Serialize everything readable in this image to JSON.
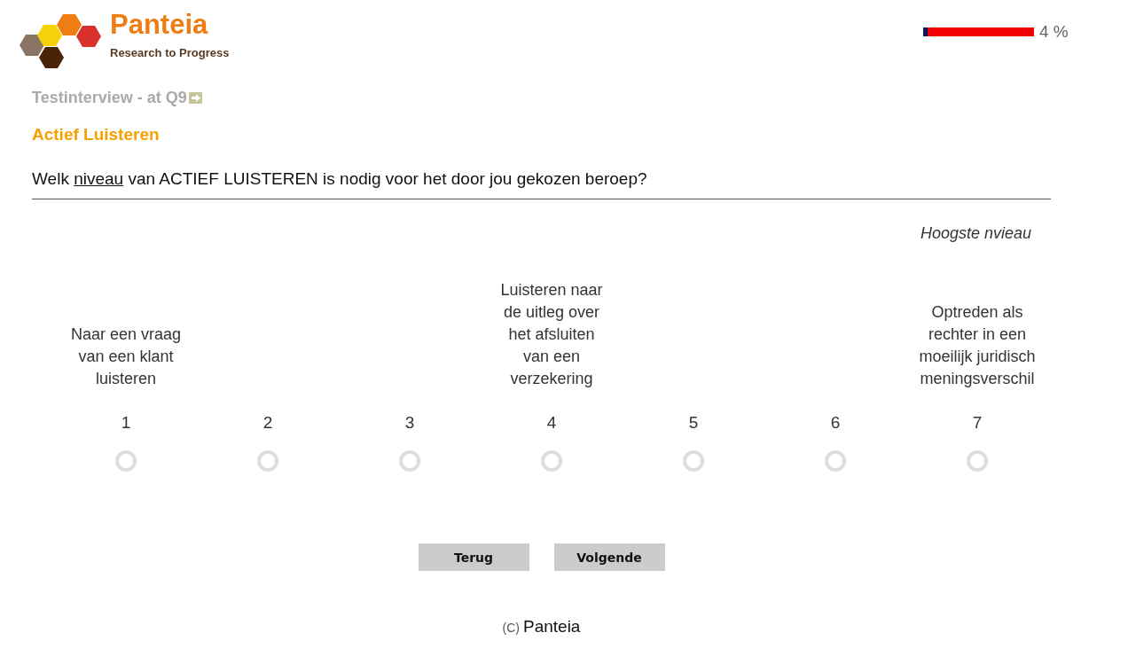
{
  "logo": {
    "name": "Panteia",
    "tagline": "Research to Progress"
  },
  "progress": {
    "level": 0.04,
    "reading": "4 %"
  },
  "breadcrumb": "Testinterview - at Q9",
  "section_title": "Actief Luisteren",
  "question": {
    "before": "Welk",
    "underlined": "niveau",
    "after": "van ACTIEF LUISTEREN is nodig voor het door jou gekozen beroep?"
  },
  "scale_top_label": "Hoogste nvieau",
  "scale": [
    {
      "value": "1",
      "anchor": "Naar een vraag van een klant luisteren",
      "selected": false
    },
    {
      "value": "2",
      "selected": false
    },
    {
      "value": "3",
      "selected": false
    },
    {
      "value": "4",
      "anchor": "Luisteren naar de uitleg over het afsluiten van een verzekering",
      "selected": false
    },
    {
      "value": "5",
      "selected": false
    },
    {
      "value": "6",
      "selected": false
    },
    {
      "value": "7",
      "anchor": "Optreden als rechter in een moeilijk juridisch meningsverschil",
      "selected": false
    }
  ],
  "buttons": [
    "Terug",
    "Volgende"
  ],
  "footer": {
    "mark": "(C)",
    "name": "Panteia"
  }
}
